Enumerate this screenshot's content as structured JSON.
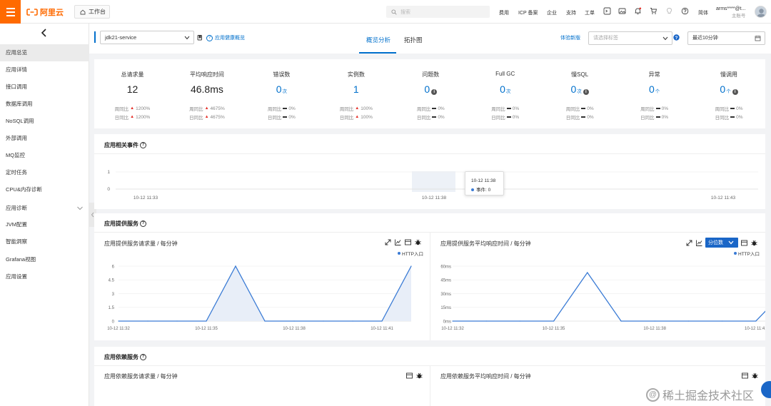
{
  "topbar": {
    "logo_text": "阿里云",
    "workbench": "工作台",
    "search_placeholder": "搜索",
    "nav": [
      "费用",
      "ICP 备案",
      "企业",
      "支持",
      "工单"
    ],
    "lang": "简体",
    "user_name": "arms****@t...",
    "user_role": "主账号"
  },
  "sidebar": {
    "items": [
      "应用总览",
      "应用详情",
      "接口调用",
      "数据库调用",
      "NoSQL调用",
      "外部调用",
      "MQ监控",
      "定时任务",
      "CPU&内存诊断",
      "应用诊断",
      "JVM配置",
      "智能洞察",
      "Grafana视图",
      "应用设置"
    ],
    "active_index": 0
  },
  "header": {
    "service": "jdk21-service",
    "health_link": "应用健康概览",
    "tabs": [
      "概览分析",
      "拓扑图"
    ],
    "active_tab": 0,
    "new_version": "体验新版",
    "tag_placeholder": "请选择标签",
    "time_range": "最近10分钟"
  },
  "stats": [
    {
      "label": "总请求量",
      "value": "12",
      "unit": "",
      "info": false,
      "blue": false,
      "week": "1200%",
      "day": "1200%",
      "trend": "up"
    },
    {
      "label": "平均响应时间",
      "value": "46.8ms",
      "unit": "",
      "info": false,
      "blue": false,
      "week": "4675%",
      "day": "4675%",
      "trend": "up"
    },
    {
      "label": "错误数",
      "value": "0",
      "unit": "次",
      "info": false,
      "blue": true,
      "week": "0%",
      "day": "0%",
      "trend": "flat"
    },
    {
      "label": "实例数",
      "value": "1",
      "unit": "",
      "info": false,
      "blue": true,
      "week": "100%",
      "day": "100%",
      "trend": "up"
    },
    {
      "label": "问题数",
      "value": "0",
      "unit": "",
      "info": true,
      "blue": true,
      "week": "0%",
      "day": "0%",
      "trend": "flat"
    },
    {
      "label": "Full GC",
      "value": "0",
      "unit": "次",
      "info": false,
      "blue": true,
      "week": "0%",
      "day": "0%",
      "trend": "flat"
    },
    {
      "label": "慢SQL",
      "value": "0",
      "unit": "次",
      "info": true,
      "blue": true,
      "week": "0%",
      "day": "0%",
      "trend": "flat"
    },
    {
      "label": "异常",
      "value": "0",
      "unit": "个",
      "info": false,
      "blue": true,
      "week": "0%",
      "day": "0%",
      "trend": "flat"
    },
    {
      "label": "慢调用",
      "value": "0",
      "unit": "个",
      "info": true,
      "blue": true,
      "week": "0%",
      "day": "0%",
      "trend": "flat"
    }
  ],
  "compare_labels": {
    "week": "周同比",
    "day": "日同比"
  },
  "events": {
    "title": "应用相关事件",
    "y_ticks": [
      "1",
      "0"
    ],
    "x_ticks": [
      "10-12 11:33",
      "10-12 11:38",
      "10-12 11:43"
    ],
    "tooltip_time": "10-12 11:38",
    "tooltip_label": "事件:",
    "tooltip_value": "0"
  },
  "provided": {
    "title": "应用提供服务",
    "quantile_label": "分位数",
    "legend": "HTTP入口"
  },
  "deps": {
    "title": "应用依赖服务",
    "left_title": "应用依赖服务请求量 / 每分钟",
    "right_title": "应用依赖服务平均响应时间 / 每分钟"
  },
  "watermark": "稀土掘金技术社区",
  "chart_data": [
    {
      "type": "area",
      "title": "应用提供服务请求量 / 每分钟",
      "series": [
        {
          "name": "HTTP入口",
          "values": [
            0,
            0,
            0,
            0,
            6,
            0,
            0,
            0,
            0,
            0,
            6
          ]
        }
      ],
      "x_ticks": [
        "10-12 11:32",
        "10-12 11:35",
        "10-12 11:38",
        "10-12 11:41"
      ],
      "y_ticks": [
        "6",
        "4.5",
        "3",
        "1.5",
        "0"
      ],
      "ylim": [
        0,
        6
      ]
    },
    {
      "type": "line",
      "title": "应用提供服务平均响应时间 / 每分钟",
      "series": [
        {
          "name": "HTTP入口",
          "values": [
            0,
            0,
            0,
            0,
            53,
            0,
            0,
            0,
            0,
            0,
            38
          ]
        }
      ],
      "x_ticks": [
        "10-12 11:32",
        "10-12 11:35",
        "10-12 11:38",
        "10-12 11:41"
      ],
      "y_ticks": [
        "60ms",
        "45ms",
        "30ms",
        "15ms",
        "0ms"
      ],
      "ylim": [
        0,
        60
      ]
    }
  ]
}
